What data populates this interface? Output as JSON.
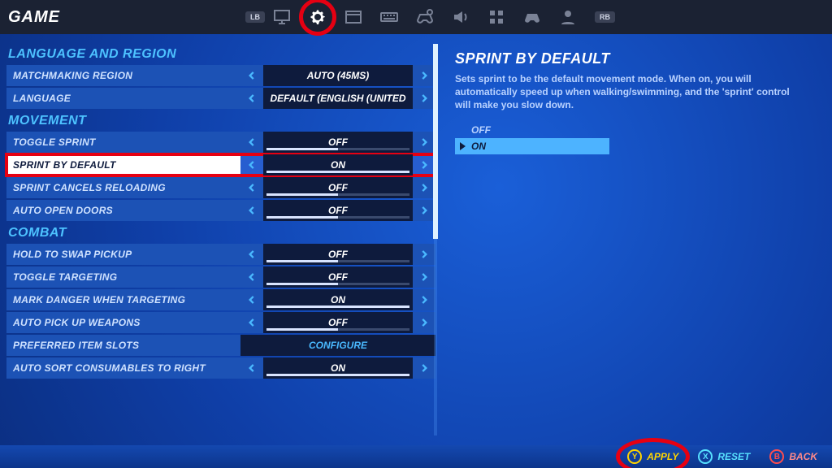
{
  "header": {
    "title": "GAME",
    "bumper_left": "LB",
    "bumper_right": "RB",
    "tabs": [
      {
        "id": "video",
        "icon": "monitor-icon"
      },
      {
        "id": "game",
        "icon": "gear-icon",
        "selected": true,
        "circled": true
      },
      {
        "id": "ui",
        "icon": "window-icon"
      },
      {
        "id": "input",
        "icon": "keyboard-icon"
      },
      {
        "id": "controller",
        "icon": "controller-gear-icon"
      },
      {
        "id": "audio",
        "icon": "speaker-icon"
      },
      {
        "id": "color",
        "icon": "swatches-icon"
      },
      {
        "id": "gamepad",
        "icon": "gamepad-icon"
      },
      {
        "id": "account",
        "icon": "person-icon"
      }
    ]
  },
  "sections": [
    {
      "id": "language_region",
      "title": "LANGUAGE AND REGION",
      "rows": [
        {
          "id": "matchmaking_region",
          "label": "MATCHMAKING REGION",
          "value": "AUTO (45MS)",
          "fill": 0,
          "showbar": false
        },
        {
          "id": "language",
          "label": "LANGUAGE",
          "value": "DEFAULT (ENGLISH (UNITED",
          "fill": 0,
          "showbar": false
        }
      ]
    },
    {
      "id": "movement",
      "title": "MOVEMENT",
      "rows": [
        {
          "id": "toggle_sprint",
          "label": "TOGGLE SPRINT",
          "value": "OFF",
          "fill": 50
        },
        {
          "id": "sprint_by_default",
          "label": "SPRINT BY DEFAULT",
          "value": "ON",
          "fill": 100,
          "selected": true,
          "circled": true
        },
        {
          "id": "sprint_cancels_reloading",
          "label": "SPRINT CANCELS RELOADING",
          "value": "OFF",
          "fill": 50
        },
        {
          "id": "auto_open_doors",
          "label": "AUTO OPEN DOORS",
          "value": "OFF",
          "fill": 50
        }
      ]
    },
    {
      "id": "combat",
      "title": "COMBAT",
      "rows": [
        {
          "id": "hold_to_swap_pickup",
          "label": "HOLD TO SWAP PICKUP",
          "value": "OFF",
          "fill": 50
        },
        {
          "id": "toggle_targeting",
          "label": "TOGGLE TARGETING",
          "value": "OFF",
          "fill": 50
        },
        {
          "id": "mark_danger_targeting",
          "label": "MARK DANGER WHEN TARGETING",
          "value": "ON",
          "fill": 100
        },
        {
          "id": "auto_pick_up_weapons",
          "label": "AUTO PICK UP WEAPONS",
          "value": "OFF",
          "fill": 50
        },
        {
          "id": "preferred_item_slots",
          "label": "PREFERRED ITEM SLOTS",
          "value": "CONFIGURE",
          "button": true,
          "showbar": false
        },
        {
          "id": "auto_sort_consumables",
          "label": "AUTO SORT CONSUMABLES TO RIGHT",
          "value": "ON",
          "fill": 100
        }
      ]
    }
  ],
  "description": {
    "title": "SPRINT BY DEFAULT",
    "body": "Sets sprint to be the default movement mode. When on, you will automatically speed up when walking/swimming, and the 'sprint' control will make you slow down.",
    "options": [
      {
        "label": "OFF",
        "selected": false
      },
      {
        "label": "ON",
        "selected": true
      }
    ]
  },
  "footer": {
    "apply": "APPLY",
    "reset": "RESET",
    "back": "BACK",
    "apply_circled": true
  }
}
